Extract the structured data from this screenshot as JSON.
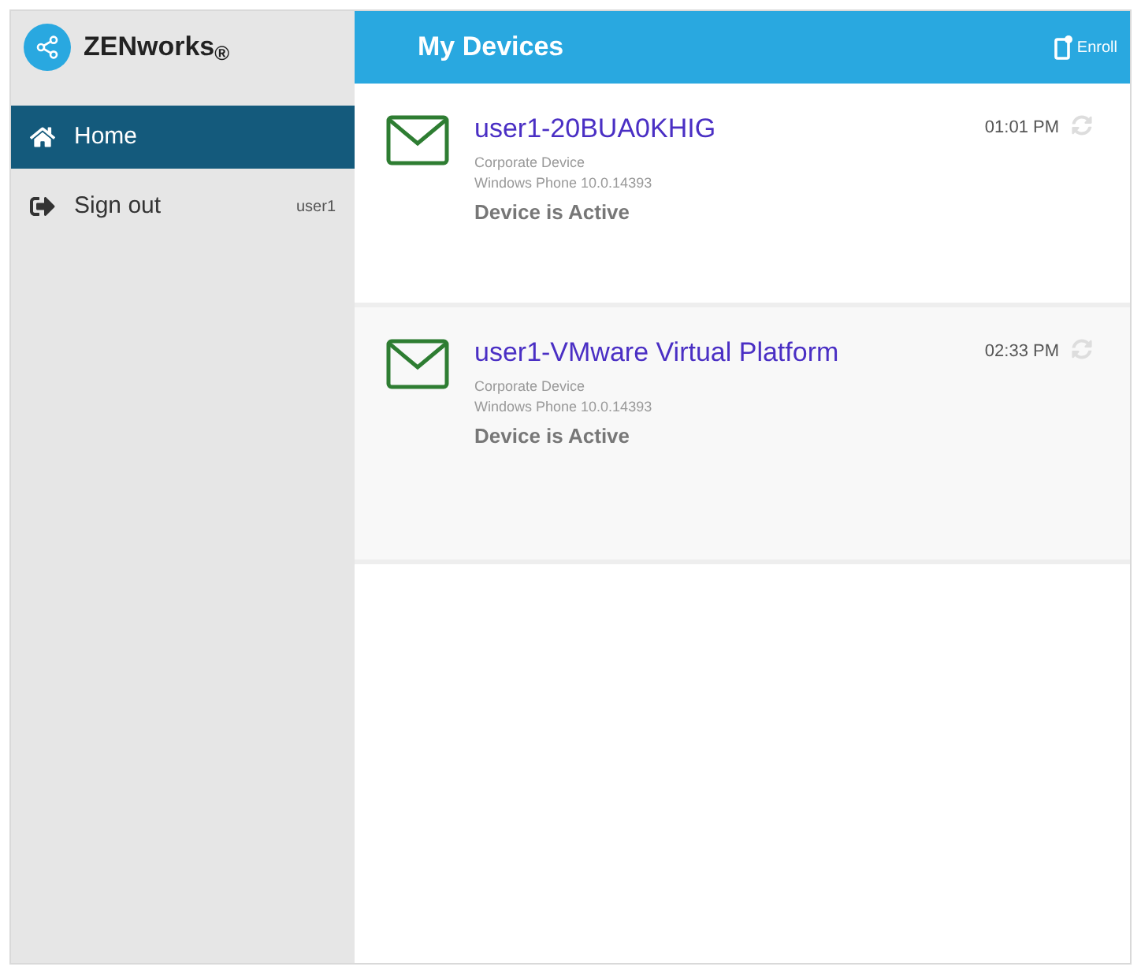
{
  "sidebar": {
    "brand": "ZENworks$_{®}$",
    "items": [
      {
        "kind": "home",
        "label": "Home",
        "selected": true
      },
      {
        "kind": "signout",
        "label": "Sign out",
        "note": "user1",
        "selected": false
      }
    ]
  },
  "header": {
    "title": "My Devices",
    "enroll": "Enroll"
  },
  "devices": [
    {
      "name": "user1-20BUA0KHIG",
      "ownership": "Corporate Device",
      "os": "Windows Phone 10.0.14393",
      "status": "Device is Active",
      "time": "01:01 PM"
    },
    {
      "name": "user1-VMware Virtual Platform",
      "ownership": "Corporate Device",
      "os": "Windows Phone 10.0.14393",
      "status": "Device is Active",
      "time": "02:33 PM"
    }
  ]
}
